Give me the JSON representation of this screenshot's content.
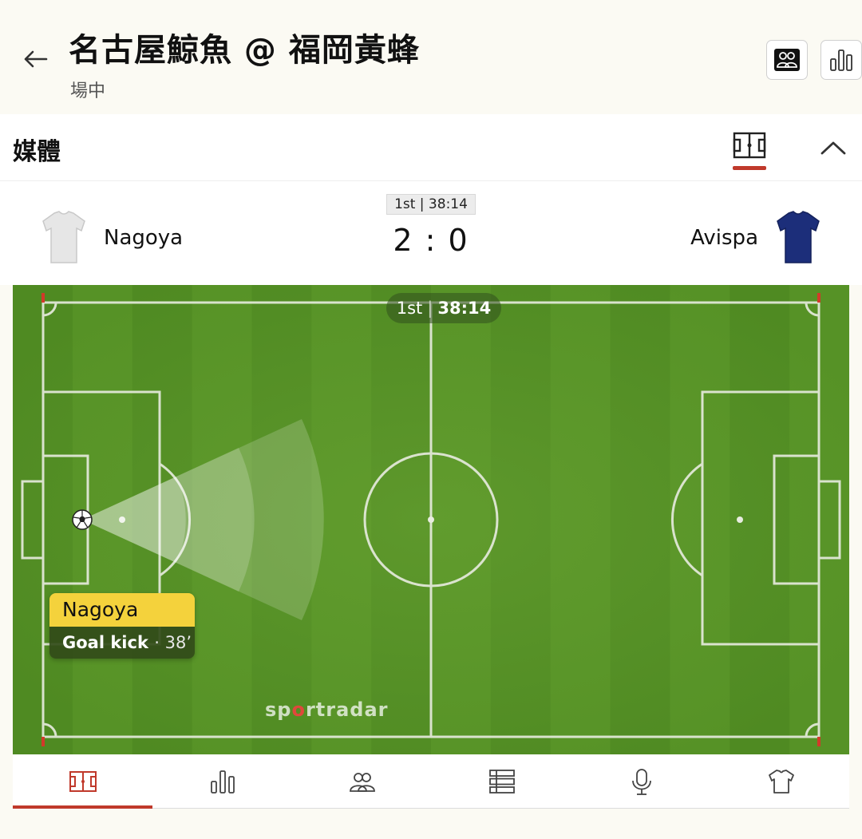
{
  "header": {
    "title": "名古屋鯨魚 @ 福岡黃蜂",
    "status": "場中",
    "icons": [
      "back-arrow-icon",
      "lineups-icon",
      "stats-bars-icon"
    ]
  },
  "media": {
    "label": "媒體",
    "icons": [
      "pitch-icon",
      "chevron-up-icon"
    ]
  },
  "scoreboard": {
    "period_clock": "1st | 38:14",
    "home_team": "Nagoya",
    "away_team": "Avispa",
    "score": "2 : 0",
    "home_jersey_color": "#e6e6e6",
    "away_jersey_color": "#1c2e7a"
  },
  "pitch": {
    "period": "1st",
    "separator": "|",
    "clock": "38:14",
    "event_team": "Nagoya",
    "event_type": "Goal kick",
    "event_minute": "· 38’",
    "brand_pre": "sp",
    "brand_o": "o",
    "brand_post": "rtradar",
    "grass_color": "#4f8a22",
    "card_color": "#f4d23c"
  },
  "tabs": [
    {
      "name": "pitch-tab",
      "icon": "pitch-icon",
      "active": true
    },
    {
      "name": "stats-tab",
      "icon": "bar-chart-icon",
      "active": false
    },
    {
      "name": "lineups-tab",
      "icon": "people-icon",
      "active": false
    },
    {
      "name": "table-tab",
      "icon": "list-table-icon",
      "active": false
    },
    {
      "name": "commentary-tab",
      "icon": "microphone-icon",
      "active": false
    },
    {
      "name": "kits-tab",
      "icon": "shirt-icon",
      "active": false
    }
  ],
  "accent_color": "#c0392b"
}
